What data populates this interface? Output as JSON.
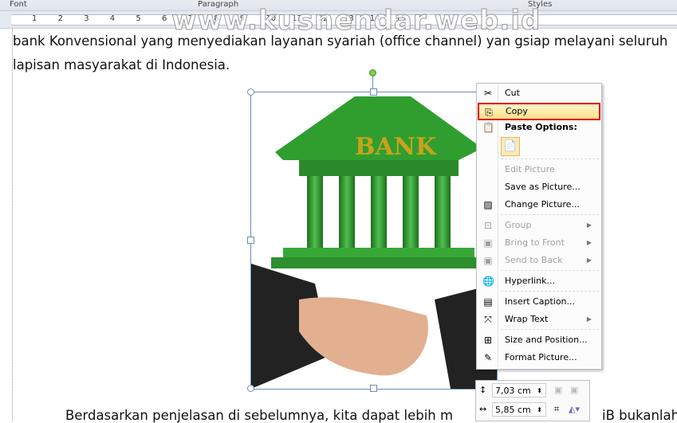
{
  "ribbon": {
    "groups": [
      "Font",
      "Paragraph",
      "Styles"
    ]
  },
  "ruler": {
    "numbers": [
      "1",
      "2",
      "3",
      "4",
      "5",
      "6",
      "7",
      "8",
      "9",
      "10",
      "11",
      "12",
      "13",
      "14",
      "15"
    ]
  },
  "watermark": "www.kusnendar.web.id",
  "document": {
    "line1": "bank Konvensional yang menyediakan layanan syariah (office channel) yan gsiap melayani seluruh",
    "line2": "lapisan masyarakat di Indonesia.",
    "line3_left": "Berdasarkan penjelasan di sebelumnya, kita dapat lebih m",
    "line3_right": "iB bukanlah"
  },
  "picture": {
    "bank_text": "BANK"
  },
  "context_menu": {
    "items": [
      {
        "label": "Cut",
        "icon": "scissors-icon",
        "disabled": false
      },
      {
        "label": "Copy",
        "icon": "copy-icon",
        "disabled": false,
        "highlighted": true
      },
      {
        "label": "Paste Options:",
        "icon": "paste-icon",
        "disabled": false,
        "header": true
      },
      {
        "label": "Edit Picture",
        "disabled": true
      },
      {
        "label": "Save as Picture...",
        "disabled": false
      },
      {
        "label": "Change Picture...",
        "icon": "change-picture-icon",
        "disabled": false
      },
      {
        "label": "Group",
        "icon": "group-icon",
        "disabled": true,
        "submenu": true
      },
      {
        "label": "Bring to Front",
        "icon": "bring-front-icon",
        "disabled": true,
        "submenu": true
      },
      {
        "label": "Send to Back",
        "icon": "send-back-icon",
        "disabled": true,
        "submenu": true
      },
      {
        "label": "Hyperlink...",
        "icon": "hyperlink-icon",
        "disabled": false
      },
      {
        "label": "Insert Caption...",
        "icon": "caption-icon",
        "disabled": false
      },
      {
        "label": "Wrap Text",
        "icon": "wrap-text-icon",
        "disabled": false,
        "submenu": true
      },
      {
        "label": "Size and Position...",
        "icon": "size-icon",
        "disabled": false
      },
      {
        "label": "Format Picture...",
        "icon": "format-picture-icon",
        "disabled": false
      }
    ]
  },
  "mini_toolbar": {
    "height": "7,03 cm",
    "width": "5,85 cm"
  },
  "colors": {
    "highlight_border": "#e00000",
    "bank_green": "#2e9a2e"
  }
}
